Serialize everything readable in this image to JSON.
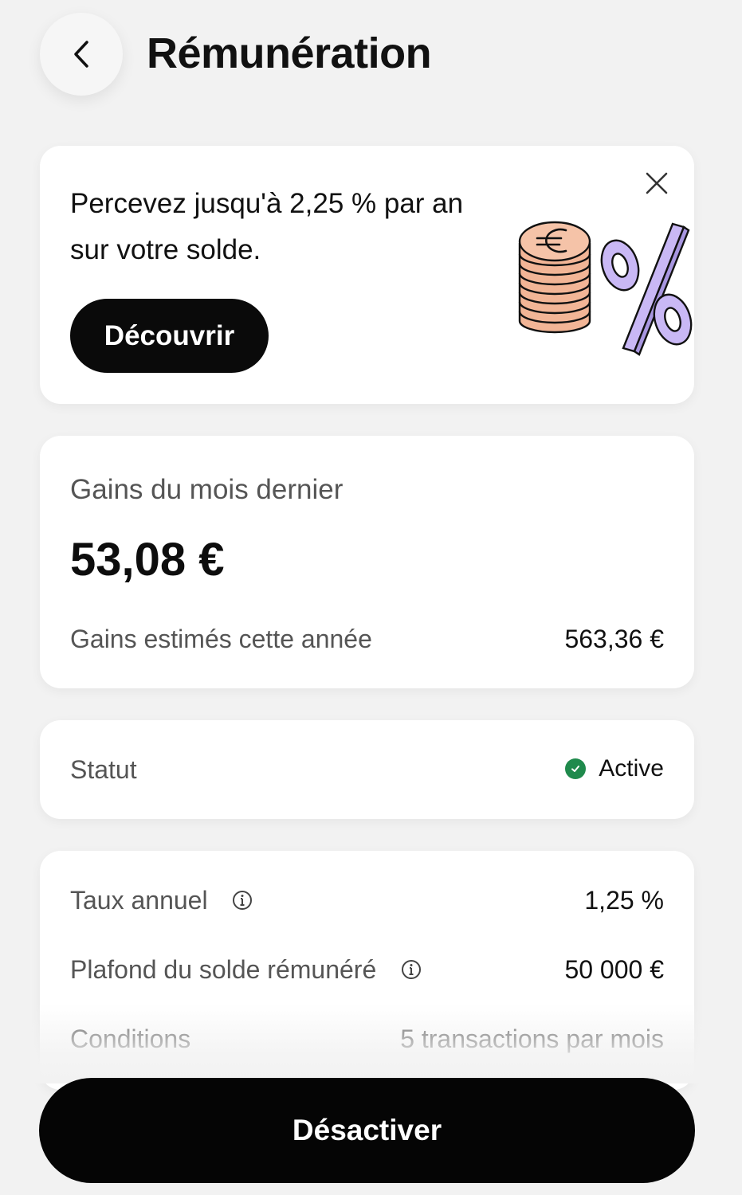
{
  "header": {
    "title": "Rémunération",
    "back_icon": "chevron-left-icon"
  },
  "promo": {
    "text": "Percevez jusqu'à 2,25 % par an sur votre solde.",
    "button_label": "Découvrir",
    "close_icon": "close-icon",
    "illustration": "euro-coins-percent-illustration",
    "colors": {
      "coins": "#f2b596",
      "percent": "#c9b8f5"
    }
  },
  "gains": {
    "label": "Gains du mois dernier",
    "amount": "53,08 €",
    "estimate_label": "Gains estimés cette année",
    "estimate_value": "563,36 €"
  },
  "status": {
    "label": "Statut",
    "value": "Active",
    "color": "#1f8a4c"
  },
  "details": {
    "rate_label": "Taux annuel",
    "rate_value": "1,25 %",
    "cap_label": "Plafond du solde rémunéré",
    "cap_value": "50 000 €",
    "conditions_label": "Conditions",
    "conditions_value": "5 transactions par mois"
  },
  "footer": {
    "button_label": "Désactiver"
  }
}
